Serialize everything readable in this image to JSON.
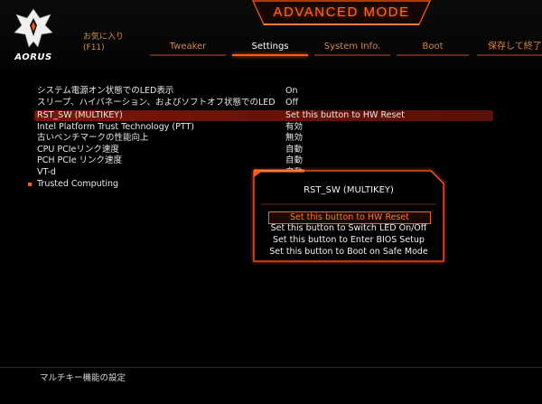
{
  "header": {
    "logo_text": "AORUS",
    "mode_title": "ADVANCED MODE",
    "favorites": {
      "line1": "お気に入り",
      "line2": "(F11)"
    },
    "tabs": [
      {
        "label": "Tweaker",
        "active": false
      },
      {
        "label": "Settings",
        "active": true
      },
      {
        "label": "System Info.",
        "active": false
      },
      {
        "label": "Boot",
        "active": false
      },
      {
        "label": "保存して終了",
        "active": false
      }
    ]
  },
  "settings": {
    "rows": [
      {
        "label": "システム電源オン状態でのLED表示",
        "value": "On"
      },
      {
        "label": "スリープ、ハイバネーション、およびソフトオフ状態でのLED",
        "value": "Off"
      },
      {
        "label": "RST_SW (MULTIKEY)",
        "value": "Set this button to HW Reset",
        "selected": true
      },
      {
        "label": "Intel Platform Trust Technology (PTT)",
        "value": "有効"
      },
      {
        "label": "古いベンチマークの性能向上",
        "value": "無効"
      },
      {
        "label": "CPU PCIeリンク速度",
        "value": "自動"
      },
      {
        "label": "PCH PCIe リンク速度",
        "value": "自動"
      },
      {
        "label": "VT-d",
        "value": "自動"
      },
      {
        "label": "Trusted Computing",
        "value": "",
        "submenu": true
      }
    ]
  },
  "popup": {
    "title": "RST_SW (MULTIKEY)",
    "options": [
      "Set this button to HW Reset",
      "Set this button to Switch LED On/Off",
      "Set this button to Enter BIOS Setup",
      "Set this button to Boot on Safe Mode"
    ],
    "selected_index": 0
  },
  "footer": {
    "help_text": "マルチキー機能の設定"
  },
  "colors": {
    "accent": "#ff5a1a",
    "tab_text": "#d98540",
    "selected_row": "#7a1608"
  }
}
